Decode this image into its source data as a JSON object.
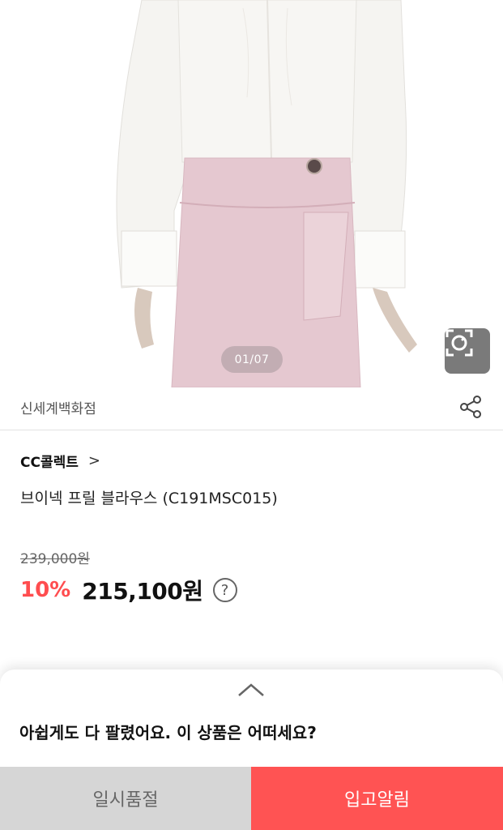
{
  "product_image": {
    "alt": "product-photo",
    "pager": "01/07"
  },
  "seller": {
    "name": "신세계백화점"
  },
  "brand": {
    "name": "CC콜렉트",
    "chevron": ">"
  },
  "product": {
    "title": "브이넥 프릴 블라우스 (C191MSC015)"
  },
  "price": {
    "original": "239,000원",
    "discount": "10%",
    "sale": "215,100원",
    "help": "?"
  },
  "sheet": {
    "message": "아쉽게도 다 팔렸어요. 이 상품은 어떠세요?",
    "soldout_label": "일시품절",
    "notify_label": "입고알림"
  },
  "colors": {
    "accent_red": "#ff4d4f",
    "notify_bg": "#ff5353",
    "soldout_bg": "#d6d6d6"
  },
  "icons": {
    "lens": "camera-lens-icon",
    "share": "share-icon",
    "handle": "chevron-up-icon"
  }
}
